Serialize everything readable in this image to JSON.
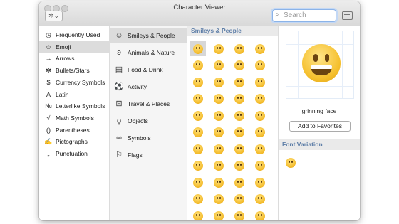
{
  "window": {
    "title": "Character Viewer"
  },
  "toolbar": {
    "gear_icon": "gear-icon",
    "search_placeholder": "Search"
  },
  "categories": [
    {
      "label": "Frequently Used",
      "icon": "clock-icon",
      "glyph": "◷"
    },
    {
      "label": "Emoji",
      "icon": "smiley-icon",
      "glyph": "☺",
      "selected": true
    },
    {
      "label": "Arrows",
      "icon": "arrow-icon",
      "glyph": "→"
    },
    {
      "label": "Bullets/Stars",
      "icon": "asterisk-icon",
      "glyph": "✻"
    },
    {
      "label": "Currency Symbols",
      "icon": "dollar-icon",
      "glyph": "$"
    },
    {
      "label": "Latin",
      "icon": "latin-a-icon",
      "glyph": "A"
    },
    {
      "label": "Letterlike Symbols",
      "icon": "numero-icon",
      "glyph": "№"
    },
    {
      "label": "Math Symbols",
      "icon": "radical-icon",
      "glyph": "√"
    },
    {
      "label": "Parentheses",
      "icon": "parentheses-icon",
      "glyph": "()"
    },
    {
      "label": "Pictographs",
      "icon": "pictograph-icon",
      "glyph": "✍"
    },
    {
      "label": "Punctuation",
      "icon": "punctuation-icon",
      "glyph": "„"
    }
  ],
  "subcategories": [
    {
      "label": "Smileys & People",
      "icon": "smiley-icon",
      "glyph": "☺",
      "selected": true
    },
    {
      "label": "Animals & Nature",
      "icon": "bear-icon",
      "glyph": "ʚ"
    },
    {
      "label": "Food & Drink",
      "icon": "food-icon",
      "glyph": "▤"
    },
    {
      "label": "Activity",
      "icon": "ball-icon",
      "glyph": "⚽"
    },
    {
      "label": "Travel & Places",
      "icon": "car-icon",
      "glyph": "⊡"
    },
    {
      "label": "Objects",
      "icon": "bulb-icon",
      "glyph": "ϙ"
    },
    {
      "label": "Symbols",
      "icon": "symbols-icon",
      "glyph": "∞"
    },
    {
      "label": "Flags",
      "icon": "flag-icon",
      "glyph": "⚐"
    }
  ],
  "emoji_grid": {
    "header": "Smileys & People",
    "rows": 11,
    "columns": 4
  },
  "detail": {
    "name": "grinning face",
    "add_favorites_label": "Add to Favorites",
    "font_variation_header": "Font Variation"
  }
}
